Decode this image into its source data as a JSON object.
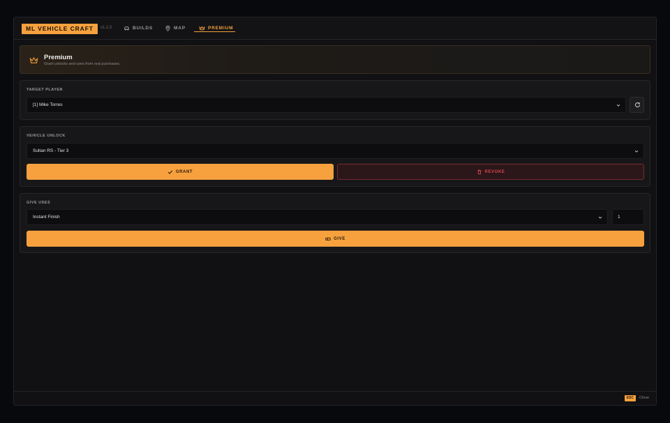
{
  "app": {
    "name": "ML VEHICLE CRAFT",
    "version": "v1.2.0",
    "accent": "#f6a13d"
  },
  "nav": {
    "tabs": [
      {
        "label": "BUILDS",
        "icon": "car-icon",
        "active": false
      },
      {
        "label": "MAP",
        "icon": "map-pin-icon",
        "active": false
      },
      {
        "label": "PREMIUM",
        "icon": "crown-icon",
        "active": true
      }
    ]
  },
  "hero": {
    "icon": "crown-icon",
    "title": "Premium",
    "subtitle": "Grant unlocks and uses from real purchases."
  },
  "target_player": {
    "label": "TARGET PLAYER",
    "selected": "[1] Mike Torres",
    "refresh_icon": "refresh-icon"
  },
  "vehicle_unlock": {
    "label": "VEHICLE UNLOCK",
    "selected": "Sultan RS - Tier 3",
    "grant_label": "GRANT",
    "revoke_label": "REVOKE"
  },
  "give_uses": {
    "label": "GIVE USES",
    "selected": "Instant Finish",
    "quantity": "1",
    "give_label": "GIVE"
  },
  "footer": {
    "key": "ESC",
    "action": "Close"
  }
}
